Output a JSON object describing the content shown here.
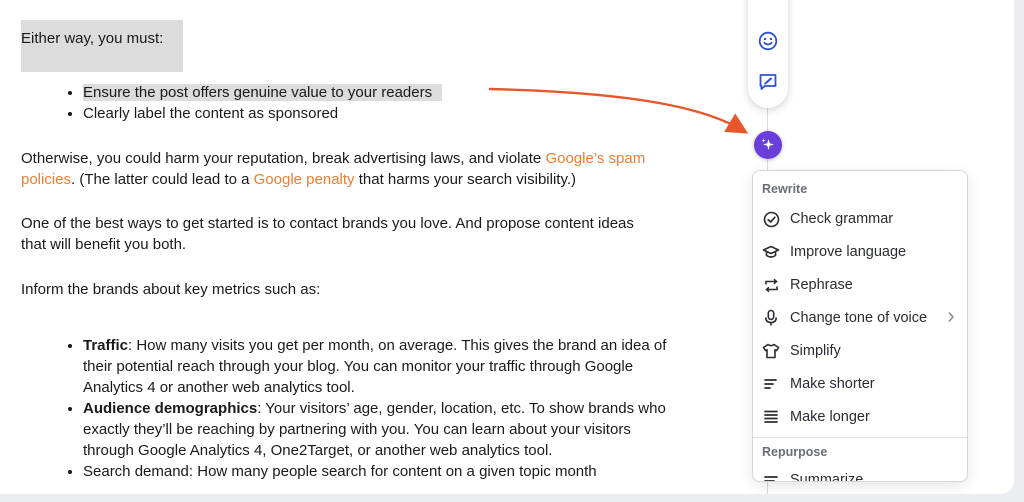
{
  "document": {
    "intro": "Either way, you must:",
    "must_items": [
      "Ensure the post offers genuine value to your readers",
      "Clearly label the content as sponsored"
    ],
    "otherwise": {
      "before": "Otherwise, you could harm your reputation, break advertising laws, and violate ",
      "link1": "Google’s spam policies",
      "middle": ". (The latter could lead to a ",
      "link2": "Google penalty",
      "after": " that harms your search visibility.)"
    },
    "contact": "One of the best ways to get started is to contact brands you love. And propose content ideas that will benefit you both.",
    "inform": "Inform the brands about key metrics such as:",
    "metrics": [
      {
        "term": "Traffic",
        "text": ": How many visits you get per month, on average. This gives the brand an idea of their potential reach through your blog. You can monitor your traffic through Google Analytics 4 or another web analytics tool."
      },
      {
        "term": "Audience demographics",
        "text": ": Your visitors’ age, gender, location, etc. To show brands who exactly they’ll be reaching by partnering with you. You can learn about your visitors through Google Analytics 4, One2Target, or another web analytics tool."
      }
    ],
    "cut_off_line": "Search demand: How many people search for content on a given topic month"
  },
  "ai_menu": {
    "rewrite_title": "Rewrite",
    "items": [
      {
        "label": "Check grammar",
        "icon": "check-circle-icon"
      },
      {
        "label": "Improve language",
        "icon": "graduation-cap-icon"
      },
      {
        "label": "Rephrase",
        "icon": "rephrase-arrows-icon"
      },
      {
        "label": "Change tone of voice",
        "icon": "microphone-icon"
      },
      {
        "label": "Simplify",
        "icon": "t-shirt-icon"
      },
      {
        "label": "Make shorter",
        "icon": "short-lines-icon"
      },
      {
        "label": "Make longer",
        "icon": "long-lines-icon"
      }
    ],
    "repurpose_title": "Repurpose",
    "repurpose_items": [
      {
        "label": "Summarize",
        "icon": "summarize-icon"
      }
    ]
  },
  "colors": {
    "link": "#ee7d32",
    "ai_accent": "#6a3fd9",
    "arrow": "#e8562a",
    "toolbar_icon": "#2c53c9"
  }
}
